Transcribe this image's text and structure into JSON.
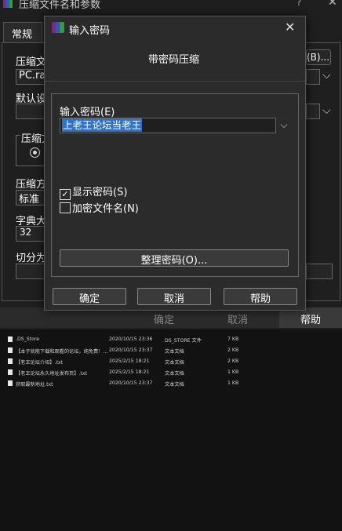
{
  "background_window": {
    "title": "压缩文件名和参数",
    "help": "?",
    "tab_general": "常规",
    "archive_name_label": "压缩文",
    "archive_name_value": "PC.rar",
    "browse_label": "(B)...",
    "default_settings_label": "默认设",
    "compress_format_label": "压缩文",
    "compress_method_label": "压缩方",
    "compress_method_value": "标准",
    "dictionary_size_label": "字典大",
    "dictionary_size_value": "32",
    "split_label": "切分为",
    "buttons": {
      "ok": "确定",
      "cancel": "取消",
      "help": "帮助"
    }
  },
  "modal": {
    "title": "输入密码",
    "header": "带密码压缩",
    "password_label": "输入密码(E)",
    "password_value": "上老王论坛当老王",
    "show_password_label": "显示密码(S)",
    "show_password_checked": true,
    "encrypt_filenames_label": "加密文件名(N)",
    "encrypt_filenames_checked": false,
    "organize_button": "整理密码(O)...",
    "buttons": {
      "ok": "确定",
      "cancel": "取消",
      "help": "帮助"
    }
  },
  "file_list": [
    {
      "name": ".DS_Store",
      "date": "2020/10/15 23:36",
      "type": "DS_STORE 文件",
      "size": "7 KB"
    },
    {
      "name": "【本子就能下载和观看的论坛，纯免费！...",
      "date": "2020/10/15 23:37",
      "type": "文本文档",
      "size": "2 KB"
    },
    {
      "name": "【老王论坛介绍】.txt",
      "date": "2025/2/15 18:21",
      "type": "文本文档",
      "size": "2 KB"
    },
    {
      "name": "【老王论坛永久地址发布页】.txt",
      "date": "2025/2/15 18:21",
      "type": "文本文档",
      "size": "1 KB"
    },
    {
      "name": "获取最新地址.txt",
      "date": "2020/10/15 23:37",
      "type": "文本文档",
      "size": "1 KB"
    }
  ]
}
